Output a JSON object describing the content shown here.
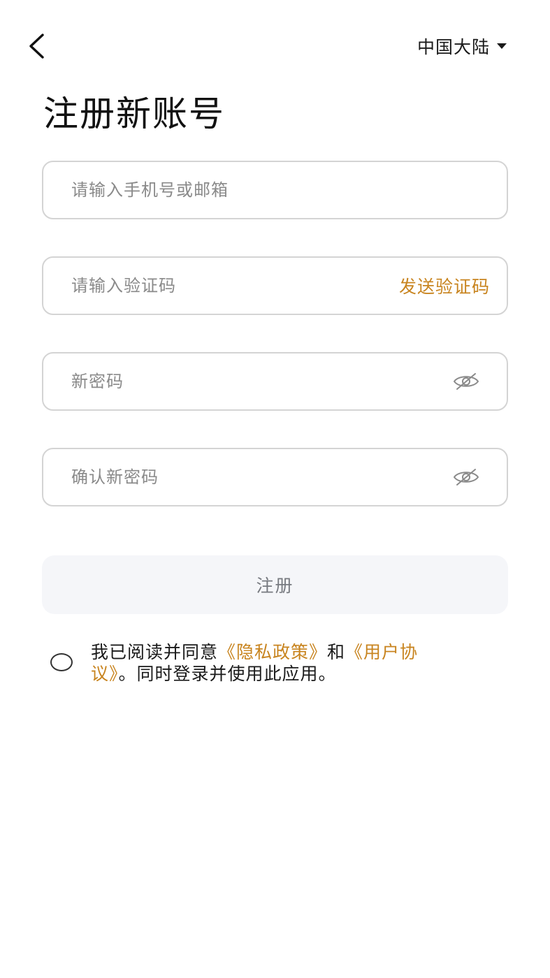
{
  "header": {
    "back_icon": "chevron-left-icon",
    "region_label": "中国大陆",
    "region_caret_icon": "caret-down-icon"
  },
  "title": "注册新账号",
  "form": {
    "account_placeholder": "请输入手机号或邮箱",
    "account_value": "",
    "code_placeholder": "请输入验证码",
    "code_value": "",
    "send_code_label": "发送验证码",
    "password_placeholder": "新密码",
    "password_value": "",
    "password_toggle_icon": "eye-off-icon",
    "confirm_placeholder": "确认新密码",
    "confirm_value": "",
    "confirm_toggle_icon": "eye-off-icon",
    "submit_label": "注册"
  },
  "agreement": {
    "checked": false,
    "prefix": "我已阅读并同意",
    "privacy_link": "《隐私政策》",
    "middle": "和",
    "terms_link": "《用户协议》",
    "suffix": "。同时登录并使用此应用。"
  },
  "colors": {
    "accent": "#c8841f",
    "border": "#d4d4d4",
    "placeholder": "#8a8a8a",
    "button_bg": "#f5f6f9",
    "button_text": "#777a80"
  }
}
